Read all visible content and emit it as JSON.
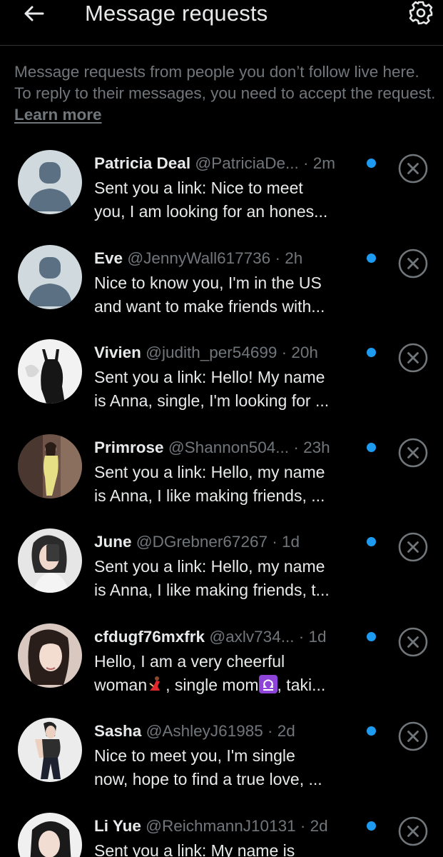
{
  "header": {
    "title": "Message requests",
    "back_icon": "arrow-left-icon",
    "settings_icon": "gear-icon"
  },
  "info": {
    "text": "Message requests from people you don’t follow live here. To reply to their messages, you need to accept the request. ",
    "link": "Learn more"
  },
  "colors": {
    "background": "#000000",
    "text_primary": "#e7e9ea",
    "text_secondary": "#71767b",
    "accent_blue": "#1d9bf0"
  },
  "requests": [
    {
      "name": "Patricia Deal",
      "handle": "@PatriciaDe...",
      "time": "2m",
      "line1": "Sent you a link: Nice to meet",
      "line2": "you, I am looking for an hones...",
      "avatar": "default-avatar"
    },
    {
      "name": "Eve",
      "handle": "@JennyWall617736",
      "time": "2h",
      "line1": "Nice to know you, I'm in the US",
      "line2": "and want to make friends with...",
      "avatar": "default-avatar"
    },
    {
      "name": "Vivien",
      "handle": "@judith_per54699",
      "time": "20h",
      "line1": "Sent you a link: Hello! My name",
      "line2": "is Anna, single, I'm looking for ...",
      "avatar": "photo-dress"
    },
    {
      "name": "Primrose",
      "handle": "@Shannon504...",
      "time": "23h",
      "line1": "Sent you a link: Hello, my name",
      "line2": "is Anna, I like making friends, ...",
      "avatar": "photo-yellow-dress"
    },
    {
      "name": "June",
      "handle": "@DGrebner67267",
      "time": "1d",
      "line1": "Sent you a link: Hello, my name",
      "line2": "is Anna, I like making friends, t...",
      "avatar": "photo-selfie"
    },
    {
      "name": "cfdugf76mxfrk",
      "handle": "@axlv734...",
      "time": "1d",
      "line1": "Hello, I am a very cheerful",
      "line2a": "woman",
      "line2b": ", single mom",
      "line2c": ", taki...",
      "avatar": "photo-portrait",
      "emoji_1": "dancer-emoji",
      "emoji_2": "libra-emoji"
    },
    {
      "name": "Sasha",
      "handle": "@AshleyJ61985",
      "time": "2d",
      "line1": "Nice to meet you, I'm single",
      "line2": "now, hope to find a true love, ...",
      "avatar": "photo-fitness"
    },
    {
      "name": "Li Yue",
      "handle": "@ReichmannJ10131",
      "time": "2d",
      "line1": "Sent you a link: My name is",
      "line2": "",
      "avatar": "photo-long-hair"
    }
  ],
  "row_separator": "·",
  "unread_icon": "unread-dot-icon",
  "dismiss_icon": "close-circle-icon"
}
